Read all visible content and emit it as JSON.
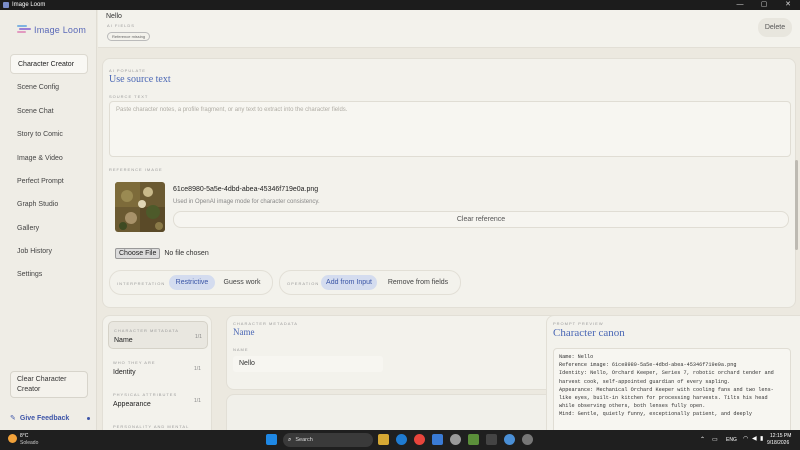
{
  "window": {
    "title": "Image Loom",
    "minimize": "—",
    "maximize": "▢",
    "close": "✕"
  },
  "logo": {
    "text": "Image Loom"
  },
  "sidebar": {
    "items": [
      {
        "label": "Character Creator",
        "active": true
      },
      {
        "label": "Scene Config"
      },
      {
        "label": "Scene Chat"
      },
      {
        "label": "Story to Comic"
      },
      {
        "label": "Image & Video"
      },
      {
        "label": "Perfect Prompt"
      },
      {
        "label": "Graph Studio"
      },
      {
        "label": "Gallery"
      },
      {
        "label": "Job History"
      },
      {
        "label": "Settings"
      }
    ],
    "clear_label": "Clear Character Creator",
    "feedback_label": "Give Feedback"
  },
  "topcard": {
    "name": "Nello",
    "ai_fields": "AI FIELDS",
    "chip": "Reference missing",
    "delete": "Delete"
  },
  "populate": {
    "eyebrow": "AI POPULATE",
    "title": "Use source text",
    "source_label": "SOURCE TEXT",
    "source_placeholder": "Paste character notes, a profile fragment, or any text to extract into the character fields.",
    "ref_label": "REFERENCE IMAGE",
    "filename": "61ce8980-5a5e-4dbd-abea-45346f719e0a.png",
    "ref_desc": "Used in OpenAI image mode for character consistency.",
    "clear_reference": "Clear reference",
    "choose_file": "Choose File",
    "no_file": "No file chosen",
    "interpretation_label": "INTERPRETATION",
    "restrictive": "Restrictive",
    "guess_work": "Guess work",
    "operation_label": "OPERATION",
    "add_from_input": "Add from Input",
    "remove_from_fields": "Remove from fields"
  },
  "sections": [
    {
      "caps": "CHARACTER METADATA",
      "title": "Name",
      "count": "1/1",
      "active": true
    },
    {
      "caps": "WHO THEY ARE",
      "title": "Identity",
      "count": "1/1"
    },
    {
      "caps": "PHYSICAL ATTRIBUTES",
      "title": "Appearance",
      "count": "1/1"
    },
    {
      "caps": "PERSONALITY AND MENTAL",
      "title": "",
      "count": ""
    }
  ],
  "metadata": {
    "caps": "CHARACTER METADATA",
    "title": "Name",
    "field_label": "NAME",
    "field_value": "Nello"
  },
  "preview": {
    "caps": "PROMPT PREVIEW",
    "title": "Character canon",
    "lines": [
      "Name: Nello",
      "Reference image: 61ce8980-5a5e-4dbd-abea-45346f719e0a.png",
      "Identity: Nello, Orchard Keeper, Series 7, robotic orchard tender and",
      "harvest cook, self-appointed guardian of every sapling.",
      "Appearance: Mechanical Orchard Keeper with cooling fans and two lens-",
      "like eyes, built-in kitchen for processing harvests. Tilts his head",
      "while observing others, both lenses fully open.",
      "Mind: Gentle, quietly funny, exceptionally patient, and deeply"
    ]
  },
  "taskbar": {
    "temp": "8°C",
    "weather": "Soleado",
    "search": "Search",
    "lang": "ENG",
    "time": "12:15 PM",
    "date": "9/18/2026"
  }
}
